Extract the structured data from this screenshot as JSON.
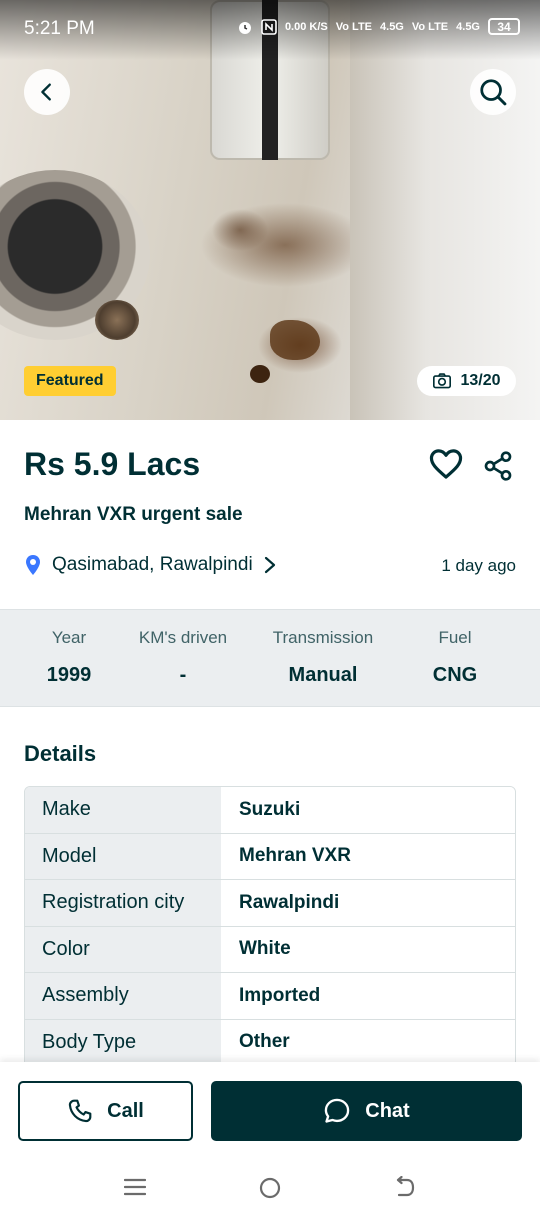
{
  "status_bar": {
    "time": "5:21 PM",
    "speed": "0.00 K/S",
    "net1": "Vo LTE",
    "sig1": "4.5G",
    "net2": "Vo LTE",
    "sig2": "4.5G",
    "battery": "34"
  },
  "gallery": {
    "badge": "Featured",
    "photo_count": "13/20"
  },
  "ad": {
    "price": "Rs 5.9 Lacs",
    "title": "Mehran VXR urgent sale",
    "location": "Qasimabad, Rawalpindi",
    "posted": "1 day ago"
  },
  "specs": [
    {
      "label": "Year",
      "value": "1999"
    },
    {
      "label": "KM's driven",
      "value": "-"
    },
    {
      "label": "Transmission",
      "value": "Manual"
    },
    {
      "label": "Fuel",
      "value": "CNG"
    }
  ],
  "details": {
    "heading": "Details",
    "rows": [
      {
        "key": "Make",
        "value": "Suzuki"
      },
      {
        "key": "Model",
        "value": "Mehran VXR"
      },
      {
        "key": "Registration city",
        "value": "Rawalpindi"
      },
      {
        "key": "Color",
        "value": "White"
      },
      {
        "key": "Assembly",
        "value": "Imported"
      },
      {
        "key": "Body Type",
        "value": "Other"
      }
    ]
  },
  "actions": {
    "call_label": "Call",
    "chat_label": "Chat"
  },
  "colors": {
    "primary": "#002f34",
    "featured": "#ffce32",
    "location_pin": "#3a77ff"
  }
}
